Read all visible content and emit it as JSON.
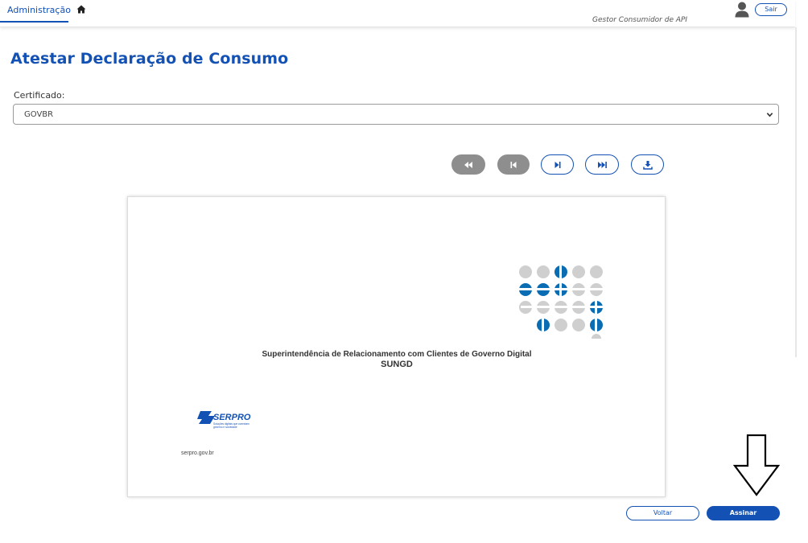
{
  "nav": {
    "tab_label": "Administração",
    "home_icon": "home-icon",
    "role_label": "Gestor Consumidor de API",
    "user_icon": "user-icon",
    "logout_label": "Sair"
  },
  "page": {
    "title": "Atestar Declaração de Consumo"
  },
  "certificate": {
    "label": "Certificado:",
    "selected": "GOVBR"
  },
  "pager": {
    "buttons": [
      {
        "name": "first-page-icon",
        "state": "disabled"
      },
      {
        "name": "previous-page-icon",
        "state": "disabled"
      },
      {
        "name": "next-page-icon",
        "state": "enabled"
      },
      {
        "name": "last-page-icon",
        "state": "enabled"
      },
      {
        "name": "download-icon",
        "state": "enabled"
      }
    ]
  },
  "document": {
    "org_name": "Superintendência de Relacionamento com Clientes de Governo Digital",
    "org_acronym": "SUNGD",
    "company_logo": "SERPRO",
    "company_tagline": "Soluções digitais que conectam governo e sociedade",
    "company_url": "serpro.gov.br"
  },
  "actions": {
    "back_label": "Voltar",
    "sign_label": "Assinar"
  },
  "colors": {
    "primary": "#1351b4",
    "disabled": "#8e8e8e",
    "logo_blue": "#0a6db3",
    "logo_gray": "#cfcfcf"
  }
}
